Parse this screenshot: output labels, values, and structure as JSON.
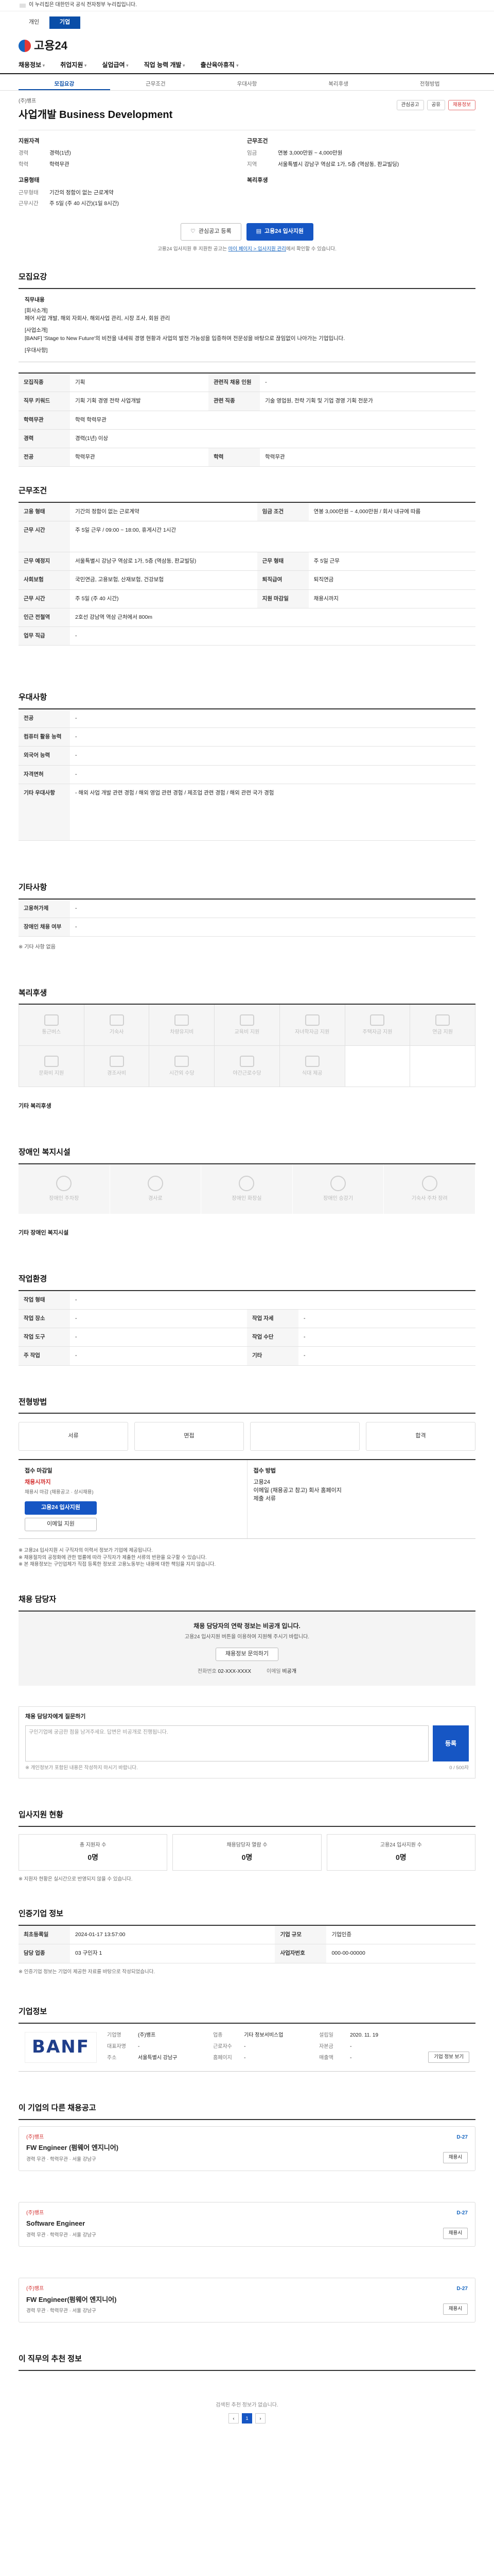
{
  "topnotice": "이 누리집은 대한민국 공식 전자정부 누리집입니다.",
  "site_tabs": [
    "개인",
    "기업"
  ],
  "logo_text": "고용24",
  "gnb": [
    "채용정보",
    "취업지원",
    "실업급여",
    "직업 능력 개발",
    "출산육아휴직 ",
    "고용안정"
  ],
  "sub_tabs": [
    "모집요강",
    "근무조건",
    "우대사항",
    "복리후생",
    "전형방법"
  ],
  "company_name": "(주)뱅프",
  "job_title": "사업개발 Business Development",
  "header_actions": [
    "관심공고",
    "공유",
    "채용정보"
  ],
  "summary": {
    "left_head": "지원자격",
    "left": [
      {
        "k": "경력",
        "v": "경력(1년)"
      },
      {
        "k": "학력",
        "v": "학력무관"
      }
    ],
    "right_head": "근무조건",
    "right": [
      {
        "k": "임금",
        "v": "연봉 3,000만원 ~ 4,000만원"
      },
      {
        "k": "지역",
        "v": "서울특별시 강남구 역삼로 1가, 5층 (역삼동, 판교빌딩)"
      }
    ],
    "left2_head": "고용형태",
    "left2": [
      {
        "k": "근무형태",
        "v": "기간의 정함이 없는 근로계약"
      },
      {
        "k": "근무시간",
        "v": "주 5일 (주 40 시간)(1일 8시간)"
      }
    ],
    "right2_head": "복리후생",
    "right2": []
  },
  "btn_interest": "관심공고 등록",
  "btn_apply": "고용24 입사지원",
  "apply_note": "고용24 입사지원 후 지원한 공고는",
  "apply_note_link": "마이 페이지 > 입사지원 관리",
  "apply_note_tail": "에서 확인할 수 있습니다.",
  "sec_recruit": {
    "title": "모집요강",
    "body_label": "직무내용",
    "body": [
      "[회사소개]",
      "페어 사업 개발, 해외 자회사, 해외사업 관리, 시장 조사, 회원 관리",
      "[사업소개]",
      "[BANF] 'Stage to New Future'의 비전을 내세워 경영 현황과 사업의 발전 가능성을 입증하며 전문성을 바탕으로 끊임없이 나아가는 기업입니다.",
      "[우대사항]"
    ]
  },
  "grid1": [
    {
      "k": "모집직종",
      "v": "기획",
      "k2": "관련직 채용 인원",
      "v2": "-"
    },
    {
      "k": "직무 키워드",
      "v": "기획 기획 경영 전략 사업개발",
      "k2": "관련 직종",
      "v2": "기술 영업원, 전략 기획 및 기업 경영 기획 전문가"
    },
    {
      "k": "학력무관",
      "v": "학력 학력무관",
      "k2": "",
      "v2": ""
    },
    {
      "k": "경력",
      "v": "경력(1년) 이상",
      "k2": "",
      "v2": ""
    },
    {
      "k": "전공",
      "v": "학력무관",
      "k2": "학력",
      "v2": "학력무관"
    }
  ],
  "sec_cond": {
    "title": "근무조건"
  },
  "grid2": [
    {
      "k": "고용 형태",
      "v": "기간의 정함이 없는 근로계약",
      "k2": "임금 조건",
      "v2": "연봉 3,000만원 ~ 4,000만원 / 회사 내규에 따름"
    },
    {
      "k": "근무 시간",
      "v": "주 5일 근무 / 09:00 ~ 18:00, 휴게시간 1시간",
      "k2": "",
      "v2": ""
    },
    {
      "k": "근무 예정지",
      "v": "서울특별시 강남구 역삼로 1가, 5층 (역삼동, 판교빌딩)",
      "k2": "근무 형태",
      "v2": "주 5일 근무"
    },
    {
      "k": "사회보험",
      "v": "국민연금, 고용보험, 산재보험, 건강보험",
      "k2": "퇴직급여",
      "v2": "퇴직연금"
    },
    {
      "k": "근무 시간",
      "v": "주 5일 (주 40 시간)",
      "k2": "지원 마감일",
      "v2": "채용시까지"
    },
    {
      "k": "인근 전철역",
      "v": "2호선 강남역 역삼 근처에서 800m",
      "k2": "",
      "v2": ""
    },
    {
      "k": "업무 직급",
      "v": "-",
      "k2": "",
      "v2": ""
    }
  ],
  "sec_pref": {
    "title": "우대사항"
  },
  "grid3": [
    {
      "k": "전공",
      "v": "-"
    },
    {
      "k": "컴퓨터 활용 능력",
      "v": "-"
    },
    {
      "k": "외국어 능력",
      "v": "-"
    },
    {
      "k": "자격면허",
      "v": "-"
    },
    {
      "k": "기타 우대사항",
      "v": "- 해외 사업 개발 관련 경험 / 해외 영업 관련 경험 / 제조업 관련 경험 / 해외 관련 국가 경험"
    }
  ],
  "sec_other": {
    "title": "기타사항"
  },
  "grid4": [
    {
      "k": "고용허가제",
      "v": "-"
    },
    {
      "k": "장애인 채용 여부",
      "v": "-"
    }
  ],
  "other_note": "※ 기타 사항 없음",
  "sec_welfare": {
    "title": "복리후생"
  },
  "welfare_icons": [
    "통근버스",
    "기숙사",
    "차량유지비",
    "교육비 지원",
    "자녀학자금 지원",
    "주택자금 지원",
    "연금 지원",
    "문화비 지원",
    "경조사비",
    "시간외 수당",
    "야간근로수당",
    "식대 제공"
  ],
  "welfare_note": "기타 복리후생",
  "sec_disab": {
    "title": "장애인 복지시설"
  },
  "disab_icons": [
    "장애인 주차장",
    "경사로",
    "장애인 화장실",
    "장애인 승강기",
    "기숙사 주차 장려"
  ],
  "disab_note": "기타 장애인 복지시설",
  "sec_workenv": {
    "title": "작업환경"
  },
  "grid5": [
    {
      "k": "작업 형태",
      "v": "-",
      "k2": "",
      "v2": ""
    },
    {
      "k": "작업 장소",
      "v": "-",
      "k2": "작업 자세",
      "v2": "-"
    },
    {
      "k": "작업 도구",
      "v": "-",
      "k2": "작업 수단",
      "v2": "-"
    },
    {
      "k": "주 작업",
      "v": "-",
      "k2": "기타",
      "v2": "-"
    }
  ],
  "sec_process": {
    "title": "전형방법"
  },
  "process_steps": [
    "서류",
    "면접",
    "",
    "합격"
  ],
  "apply_method": {
    "left_head": "접수 마감일",
    "left_val": "채용시까지",
    "left_note": "채용시 마감 (채용공고 · 상시채용)",
    "right_head": "접수 방법",
    "right_lines": [
      "고용24",
      "이메일 (채용공고 참고) 회사 홈페이지",
      "제출 서류"
    ],
    "btn_apply": "고용24 입사지원",
    "btn_mail": "이메일 지원"
  },
  "notice_lines": [
    "※ 고용24 입사지원 시 구직자의 이력서 정보가 기업에 제공됩니다.",
    "※ 채용절차의 공정화에 관한 법률에 따라 구직자가 제출한 서류의 반환을 요구할 수 있습니다.",
    "※ 본 채용정보는 구인업체가 직접 등록한 정보로 고용노동부는 내용에 대한 책임을 지지 않습니다."
  ],
  "sec_contact": {
    "title": "채용 담당자"
  },
  "contact_msg": "채용 담당자의 연락 정보는 비공개 입니다.",
  "contact_sub": "고용24 입사지원 버튼을 이용하여 지원해 주시기 바랍니다.",
  "contact_btn": "채용정보 문의하기",
  "contact_k1": "전화번호",
  "contact_v1": "02-XXX-XXXX",
  "contact_k2": "이메일",
  "contact_v2": "비공개",
  "sec_inquiry": {
    "title": "채용 담당자에게 질문하기"
  },
  "inquiry_placeholder": "구인기업에 궁금한 점을 남겨주세요. 답변은 비공개로 진행됩니다.",
  "inquiry_btn": "등록",
  "inquiry_count": "0 / 500자",
  "inquiry_note": "※ 개인정보가 포함된 내용은 작성하지 마시기 바랍니다.",
  "sec_stats": {
    "title": "입사지원 현황"
  },
  "stats": [
    {
      "label": "총 지원자 수",
      "val": "0명"
    },
    {
      "label": "채용담당자 열람 수",
      "val": "0명"
    },
    {
      "label": "고용24 입사지원 수",
      "val": "0명"
    }
  ],
  "stats_note": "※ 지원자 현황은 실시간으로 반영되지 않을 수 있습니다.",
  "sec_info": {
    "title": "인증기업 정보"
  },
  "grid6": [
    {
      "k": "최초등록일",
      "v": "2024-01-17 13:57:00",
      "k2": "기업 규모",
      "v2": "기업인증"
    },
    {
      "k": "담당 업종",
      "v": "03 구인자 1",
      "k2": "사업자번호",
      "v2": "000-00-00000"
    }
  ],
  "info_note": "※ 인증기업 정보는 기업이 제공한 자료를 바탕으로 작성되었습니다.",
  "sec_company": {
    "title": "기업정보"
  },
  "company_logo": "BANF",
  "company_info": [
    {
      "k": "기업명",
      "v": "(주)뱅프"
    },
    {
      "k": "업종",
      "v": "기타 정보서비스업"
    },
    {
      "k": "설립일",
      "v": "2020. 11. 19"
    },
    {
      "k": "대표자명",
      "v": "-"
    },
    {
      "k": "근로자수",
      "v": "-"
    },
    {
      "k": "자본금",
      "v": "-"
    },
    {
      "k": "주소",
      "v": "서울특별시 강남구"
    },
    {
      "k": "홈페이지",
      "v": "-"
    },
    {
      "k": "매출액",
      "v": "-"
    }
  ],
  "company_btn": "기업 정보 보기",
  "sec_jobs": {
    "title": "이 기업의 다른 채용공고"
  },
  "jobs": [
    {
      "co": "(주)뱅프",
      "title": "FW Engineer (펌웨어 엔지니어)",
      "meta": "경력 무관 · 학력무관 · 서울 강남구",
      "dday": "D-27",
      "btn": "채용시"
    },
    {
      "co": "(주)뱅프",
      "title": "Software Engineer",
      "meta": "경력 무관 · 학력무관 · 서울 강남구",
      "dday": "D-27",
      "btn": "채용시"
    },
    {
      "co": "(주)뱅프",
      "title": "FW Engineer(펌웨어 엔지니어)",
      "meta": "경력 무관 · 학력무관 · 서울 강남구",
      "dday": "D-27",
      "btn": "채용시"
    }
  ],
  "sec_similar": {
    "title": "이 직무의 추천 정보"
  },
  "footer_msg": "검색된 추천 정보가 없습니다.",
  "pages": [
    "1"
  ]
}
